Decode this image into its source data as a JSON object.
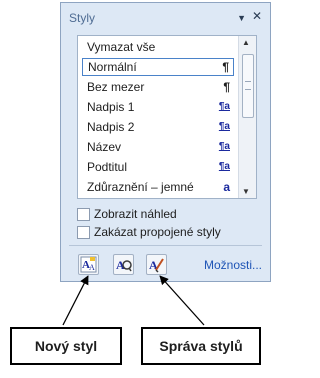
{
  "pane": {
    "title": "Styly",
    "menu_icon": "dropdown-arrow-icon",
    "close_icon": "close-icon",
    "styles": [
      {
        "label": "Vymazat vše",
        "marker": ""
      },
      {
        "label": "Normální",
        "marker": "¶",
        "selected": true
      },
      {
        "label": "Bez mezer",
        "marker": "¶"
      },
      {
        "label": "Nadpis 1",
        "marker": "¶a"
      },
      {
        "label": "Nadpis 2",
        "marker": "¶a"
      },
      {
        "label": "Název",
        "marker": "¶a"
      },
      {
        "label": "Podtitul",
        "marker": "¶a"
      },
      {
        "label": "Zdůraznění – jemné",
        "marker": "a"
      }
    ],
    "show_preview_label": "Zobrazit náhled",
    "disable_linked_label": "Zakázat propojené styly",
    "options_link": "Možnosti..."
  },
  "callouts": {
    "new_style": "Nový styl",
    "manage_styles": "Správa stylů"
  },
  "colors": {
    "pane_bg": "#dde8f5",
    "accent_link": "#1f55b6"
  }
}
